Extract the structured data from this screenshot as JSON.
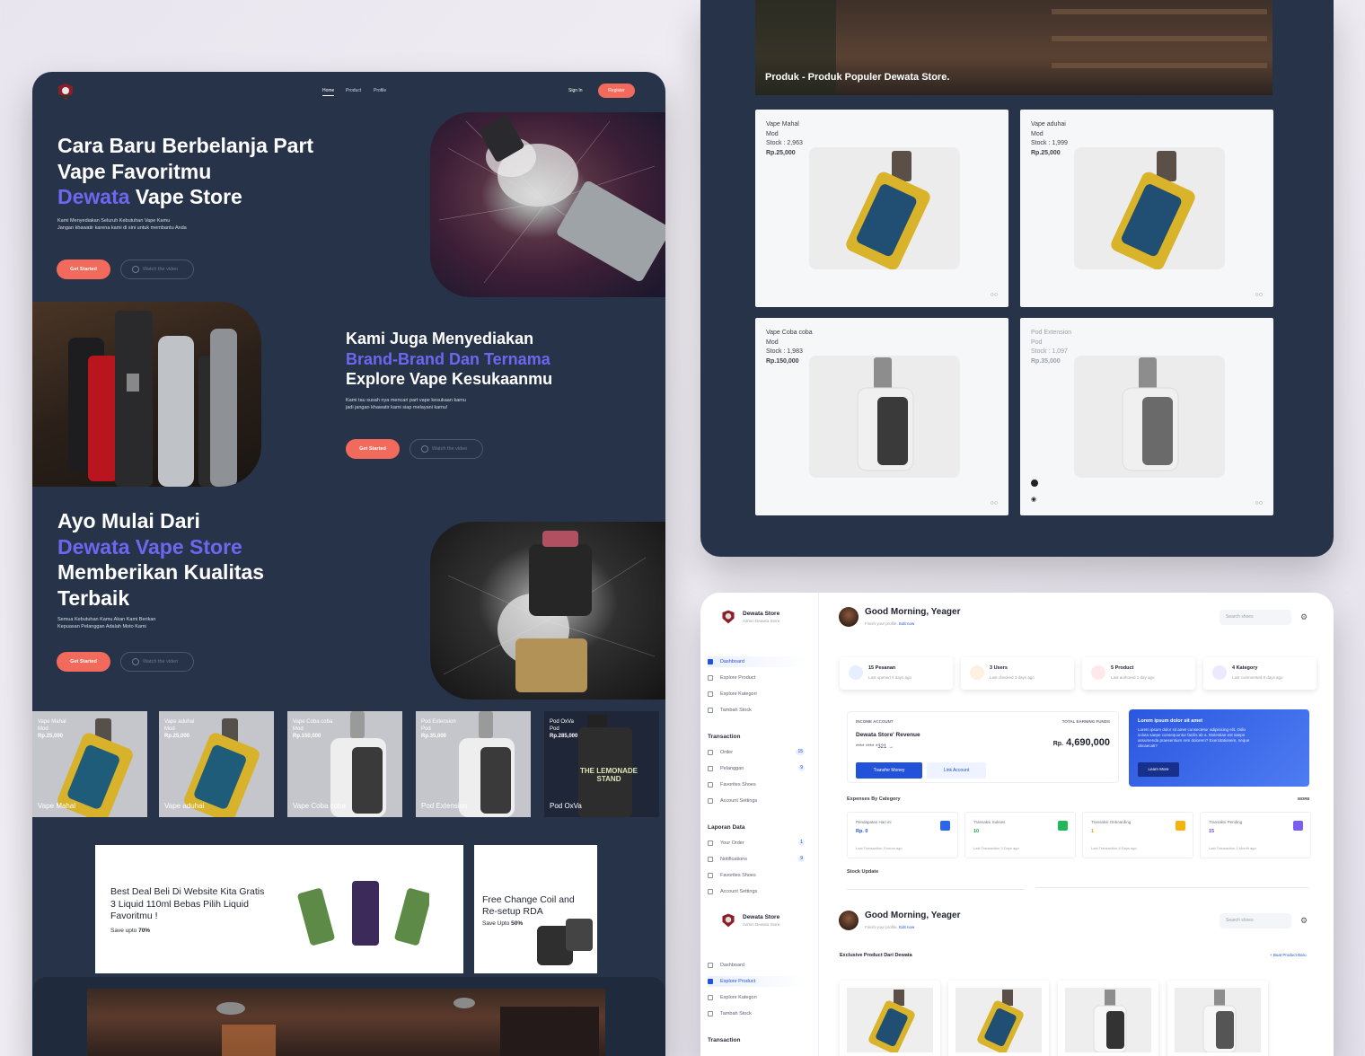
{
  "landing": {
    "nav": {
      "home": "Home",
      "product": "Product",
      "profile": "Profile",
      "signin": "Sign In",
      "register": "Register"
    },
    "hero1": {
      "line1": "Cara Baru Berbelanja Part",
      "line2": "Vape Favoritmu",
      "highlight": "Dewata",
      "rest": " Vape Store",
      "sub1": "Kami Menyediakan Seluruh Kebutuhan Vape Kamu",
      "sub2": "Jangan khawatir karena kami di sini untuk membantu Anda",
      "cta": "Get Started",
      "video": "Watch the video"
    },
    "hero2": {
      "line1": "Kami Juga Menyediakan",
      "line2": "Brand-Brand Dan Ternama",
      "line3": "Explore Vape Kesukaanmu",
      "sub1": "Kami tau susah nya mencari part vape kesukaan kamu",
      "sub2": "jadi jangan khawatir kami siap melayani kamu!",
      "cta": "Get Started",
      "video": "Watch the video"
    },
    "hero3": {
      "line1": "Ayo Mulai Dari",
      "line2": "Dewata Vape Store",
      "line3": "Memberikan Kualitas",
      "line4": "Terbaik",
      "sub1": "Semua Kebutuhan Kamu Akan Kami Berikan",
      "sub2": "Kepuasan Pelanggan Adalah Moto Kami",
      "cta": "Get Started",
      "video": "Watch the video"
    },
    "products": [
      {
        "name": "Vape Mahal",
        "cat": "Mod",
        "price": "Rp.25,000"
      },
      {
        "name": "Vape aduhai",
        "cat": "Mod",
        "price": "Rp.25,000"
      },
      {
        "name": "Vape Coba coba",
        "cat": "Mod",
        "price": "Rp.150,000"
      },
      {
        "name": "Pod Extension",
        "cat": "Pod",
        "price": "Rp.35,000"
      },
      {
        "name": "Pod OxVa",
        "cat": "Pod",
        "price": "Rp.285,000"
      }
    ],
    "promo1": {
      "line1": "Best Deal Beli Di Website Kita Gratis",
      "line2": "3 Liquid 110ml Bebas Pilih Liquid",
      "line3": "Favoritmu !",
      "save": "Save upto ",
      "pct": "70%"
    },
    "promo2": {
      "line1": "Free Change Coil and",
      "line2": "Re-setup RDA",
      "save": "Save Upto ",
      "pct": "50%"
    },
    "bottle_label": "THE LEMONADE STAND"
  },
  "popular": {
    "banner": "Produk - Produk Populer Dewata Store.",
    "items": [
      {
        "name": "Vape Mahal",
        "cat": "Mod",
        "stock": "Stock : 2,963",
        "price": "Rp.25,000"
      },
      {
        "name": "Vape aduhai",
        "cat": "Mod",
        "stock": "Stock : 1,999",
        "price": "Rp.25,000"
      },
      {
        "name": "Vape Coba coba",
        "cat": "Mod",
        "stock": "Stock : 1,983",
        "price": "Rp.150,000"
      },
      {
        "name": "Pod Extension",
        "cat": "Pod",
        "stock": "Stock : 1,097",
        "price": "Rp.35,000"
      }
    ]
  },
  "dashboard": {
    "store": "Dewata Store",
    "admin": "Admin Dewata Store",
    "greeting": "Good Morning, Yeager",
    "finish": "Finish your profile. ",
    "edit": "Edit now",
    "search": "Search shoes",
    "menu": {
      "dashboard": "Dashboard",
      "explore": "Explore Product",
      "kategori": "Explore Kategori",
      "tambah": "Tambah Stock"
    },
    "transaction": "Transaction",
    "tx": {
      "order": "Order",
      "order_n": "15",
      "pelanggan": "Pelanggan",
      "pel_n": "9",
      "fav": "Favorites Shoes",
      "acc": "Account Settings"
    },
    "laporan": "Laporan Data",
    "lp": {
      "your": "Your Order",
      "your_n": "1",
      "notif": "Notifications",
      "notif_n": "9",
      "fav": "Favorites Shoes",
      "acc": "Account Settings"
    },
    "stats": [
      {
        "t": "15 Pesanan",
        "s": "Last opened 4 days ago"
      },
      {
        "t": "3 Users",
        "s": "Last checked 3 days ago"
      },
      {
        "t": "5 Product",
        "s": "Last authored 1 day ago"
      },
      {
        "t": "4 Kategory",
        "s": "Last commented 8 days ago"
      }
    ],
    "income": {
      "label": "INCOME ACCOUNT",
      "total": "TOTAL EARNING FUNDS",
      "name": "Dewata Store' Revenue",
      "card": "**** **** *321",
      "arrow": "→",
      "rp": "Rp.",
      "amount": "4,690,000",
      "transfer": "Transfer Money",
      "link": "Link Account"
    },
    "lorem": {
      "title": "Lorem ipsum dolor sit amet",
      "body": "Lorem ipsum dolor sit amet consectetur adipisicing elit. Odio soluta saepe consequuntur facilis ab a. Molestiae est saepe assumenda praesentium rem dolorem? Exercitationem, neque obcaecati?",
      "btn": "Learn More"
    },
    "expenses": "Expenses By Category",
    "more": "MORE",
    "mini": [
      {
        "a": "Pendapatan Hari ini",
        "b": "Rp. 0",
        "c": "Last Transaction 3 hours ago"
      },
      {
        "a": "Transaksi Sukses",
        "b": "10",
        "c": "Last Transaction 3 Days ago"
      },
      {
        "a": "Transaksi Onboarding",
        "b": "1",
        "c": "Last Transaction 5 Days ago"
      },
      {
        "a": "Transaksi Pending",
        "b": "15",
        "c": "Last Transaction 1 Month ago"
      }
    ],
    "stock": "Stock Update",
    "exclusive": "Exclusive Product Dari Dewata",
    "buat": "+ Buat Product Baru"
  }
}
